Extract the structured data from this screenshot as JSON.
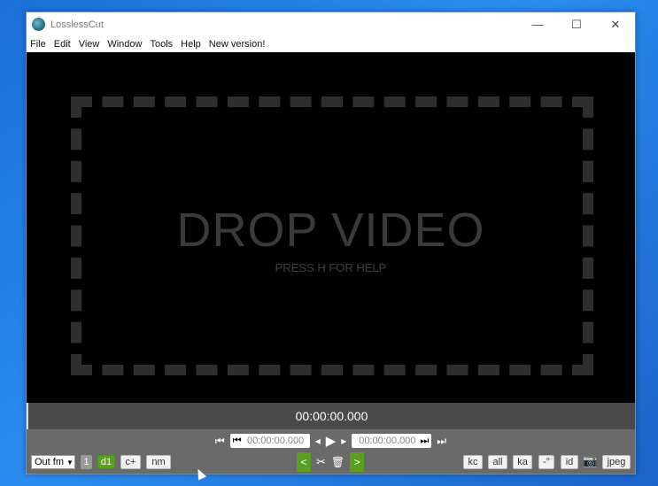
{
  "window": {
    "title": "LosslessCut",
    "minimize": "—",
    "maximize": "☐",
    "close": "✕"
  },
  "menu": [
    "File",
    "Edit",
    "View",
    "Window",
    "Tools",
    "Help",
    "New version!"
  ],
  "video": {
    "drop_title": "DROP VIDEO",
    "drop_subtitle": "PRESS H FOR HELP"
  },
  "timeline": {
    "current_time": "00:00:00.000"
  },
  "controls": {
    "cut_start": "00:00:00.000",
    "cut_end": "00:00:00.000",
    "output_format": "Out fm",
    "segment_number": "1",
    "d1_label": "d1",
    "c_plus_label": "c+",
    "nm_label": "nm",
    "kc_label": "kc",
    "all_label": "all",
    "ka_label": "ka",
    "minus_label": "-°",
    "id_label": "id",
    "jpeg_label": "jpeg"
  },
  "colors": {
    "accent_green": "#5aa020",
    "control_bg": "#6a6a6a",
    "timeline_bg": "#4a4a4a"
  }
}
